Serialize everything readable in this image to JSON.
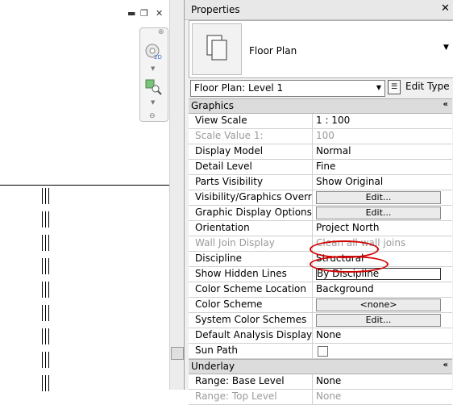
{
  "view": {
    "window_controls": [
      "minimize-icon",
      "restore-icon",
      "close-icon"
    ],
    "nav_bar_icons": [
      "steering-wheel-icon",
      "zoom-icon"
    ],
    "grid_markers": 9
  },
  "panel": {
    "title": "Properties",
    "type_name": "Floor Plan",
    "selector_value": "Floor Plan: Level 1",
    "edit_type_label": "Edit Type",
    "sections": [
      {
        "title": "Graphics",
        "rows": [
          {
            "name": "View Scale",
            "value": "1 : 100",
            "kind": "text"
          },
          {
            "name": "Scale Value    1:",
            "value": "100",
            "kind": "dim"
          },
          {
            "name": "Display Model",
            "value": "Normal",
            "kind": "text"
          },
          {
            "name": "Detail Level",
            "value": "Fine",
            "kind": "text"
          },
          {
            "name": "Parts Visibility",
            "value": "Show Original",
            "kind": "text"
          },
          {
            "name": "Visibility/Graphics Overrides",
            "value": "Edit...",
            "kind": "button"
          },
          {
            "name": "Graphic Display Options",
            "value": "Edit...",
            "kind": "button"
          },
          {
            "name": "Orientation",
            "value": "Project North",
            "kind": "text"
          },
          {
            "name": "Wall Join Display",
            "value": "Clean all wall joins",
            "kind": "dim"
          },
          {
            "name": "Discipline",
            "value": "Structural",
            "kind": "text"
          },
          {
            "name": "Show Hidden Lines",
            "value": "By Discipline",
            "kind": "box"
          },
          {
            "name": "Color Scheme Location",
            "value": "Background",
            "kind": "text"
          },
          {
            "name": "Color Scheme",
            "value": "<none>",
            "kind": "button"
          },
          {
            "name": "System Color Schemes",
            "value": "Edit...",
            "kind": "button"
          },
          {
            "name": "Default Analysis Display St...",
            "value": "None",
            "kind": "text"
          },
          {
            "name": "Sun Path",
            "value": "",
            "kind": "checkbox"
          }
        ]
      },
      {
        "title": "Underlay",
        "rows": [
          {
            "name": "Range: Base Level",
            "value": "None",
            "kind": "text"
          },
          {
            "name": "Range: Top Level",
            "value": "None",
            "kind": "dim"
          }
        ]
      }
    ],
    "collapse_icon": "«",
    "highlight_color": "#d40000"
  }
}
